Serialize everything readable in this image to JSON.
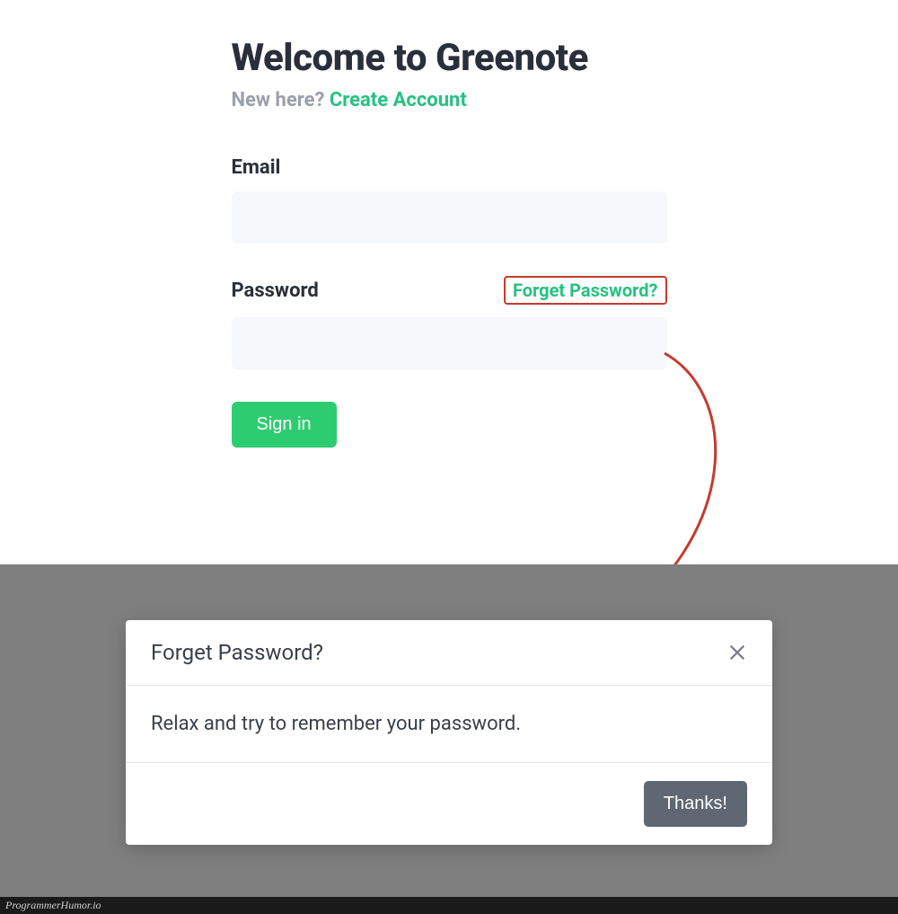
{
  "login": {
    "title": "Welcome to Greenote",
    "new_here": "New here?",
    "create_account": "Create Account",
    "email_label": "Email",
    "email_value": "",
    "password_label": "Password",
    "password_value": "",
    "forget_link": "Forget Password?",
    "signin_label": "Sign in"
  },
  "modal": {
    "title": "Forget Password?",
    "body": "Relax and try to remember your password.",
    "thanks_label": "Thanks!"
  },
  "watermark": "ProgrammerHumor.io"
}
